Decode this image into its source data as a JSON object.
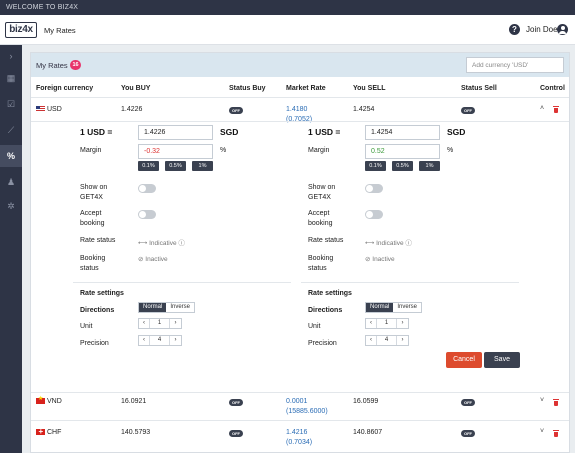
{
  "topbar": {
    "title": "WELCOME TO BIZ4X"
  },
  "header": {
    "logo": "biz4x",
    "title": "My Rates",
    "help_icon": "help-icon",
    "user_name": "Join Doe",
    "user_icon": "user-icon"
  },
  "sidebar": {
    "icons": [
      "chevron-right-icon",
      "dashboard-icon",
      "checklist-icon",
      "chart-icon",
      "percent-icon",
      "users-icon",
      "gear-icon"
    ],
    "glyphs": [
      "›",
      "▦",
      "☑",
      "⟋",
      "%",
      "♟",
      "✲"
    ]
  },
  "panel": {
    "title": "My Rates",
    "count": "16",
    "add_placeholder": "Add currency 'USD'"
  },
  "columns": [
    "Foreign currency",
    "You BUY",
    "Status Buy",
    "Market Rate",
    "You SELL",
    "Status Sell",
    "Control"
  ],
  "rows": [
    {
      "currency": "USD",
      "flag": "flag-us",
      "buy": "1.4226",
      "status_buy": "OFF",
      "market_rate": "1.4180",
      "market_rate_inverse": "(0.7052)",
      "sell": "1.4254",
      "status_sell": "OFF",
      "expand_glyph": "˄"
    },
    {
      "currency": "VND",
      "flag": "flag-vn",
      "buy": "16.0921",
      "status_buy": "OFF",
      "market_rate": "0.0001",
      "market_rate_inverse": "(15885.6000)",
      "sell": "16.0599",
      "status_sell": "OFF",
      "expand_glyph": "˅"
    },
    {
      "currency": "CHF",
      "flag": "flag-ch",
      "buy": "140.5793",
      "status_buy": "OFF",
      "market_rate": "1.4216",
      "market_rate_inverse": "(0.7034)",
      "sell": "140.8607",
      "status_sell": "OFF",
      "expand_glyph": "˅"
    }
  ],
  "editor": {
    "buy": {
      "rate_label": "1 USD =",
      "rate_value": "1.4226",
      "target": "SGD",
      "margin_label": "Margin",
      "margin_value": "-0.32",
      "margin_unit": "%",
      "presets": [
        "0.1%",
        "0.5%",
        "1%"
      ],
      "show_label": "Show on GET4X",
      "accept_label": "Accept booking",
      "rate_status_label": "Rate status",
      "rate_status": "Indicative",
      "booking_status_label": "Booking status",
      "booking_status": "Inactive",
      "settings_label": "Rate settings",
      "directions_label": "Directions",
      "direction_options": [
        "Normal",
        "Inverse"
      ],
      "unit_label": "Unit",
      "unit_value": "1",
      "precision_label": "Precision",
      "precision_value": "4"
    },
    "sell": {
      "rate_label": "1 USD =",
      "rate_value": "1.4254",
      "target": "SGD",
      "margin_label": "Margin",
      "margin_value": "0.52",
      "margin_unit": "%",
      "presets": [
        "0.1%",
        "0.5%",
        "1%"
      ],
      "show_label": "Show on GET4X",
      "accept_label": "Accept booking",
      "rate_status_label": "Rate status",
      "rate_status": "Indicative",
      "booking_status_label": "Booking status",
      "booking_status": "Inactive",
      "settings_label": "Rate settings",
      "directions_label": "Directions",
      "direction_options": [
        "Normal",
        "Inverse"
      ],
      "unit_label": "Unit",
      "unit_value": "1",
      "precision_label": "Precision",
      "precision_value": "4"
    },
    "stepper_minus": "‹",
    "stepper_plus": "›",
    "cancel_label": "Cancel",
    "save_label": "Save"
  },
  "colors": {
    "sidebar": "#2e3446",
    "panel_header": "#d9e6ef",
    "badge": "#e8336b",
    "link": "#2a6cb5",
    "negative": "#dd3333",
    "positive": "#3a9a3a",
    "cancel": "#dd4b2e",
    "save": "#3a4150"
  }
}
